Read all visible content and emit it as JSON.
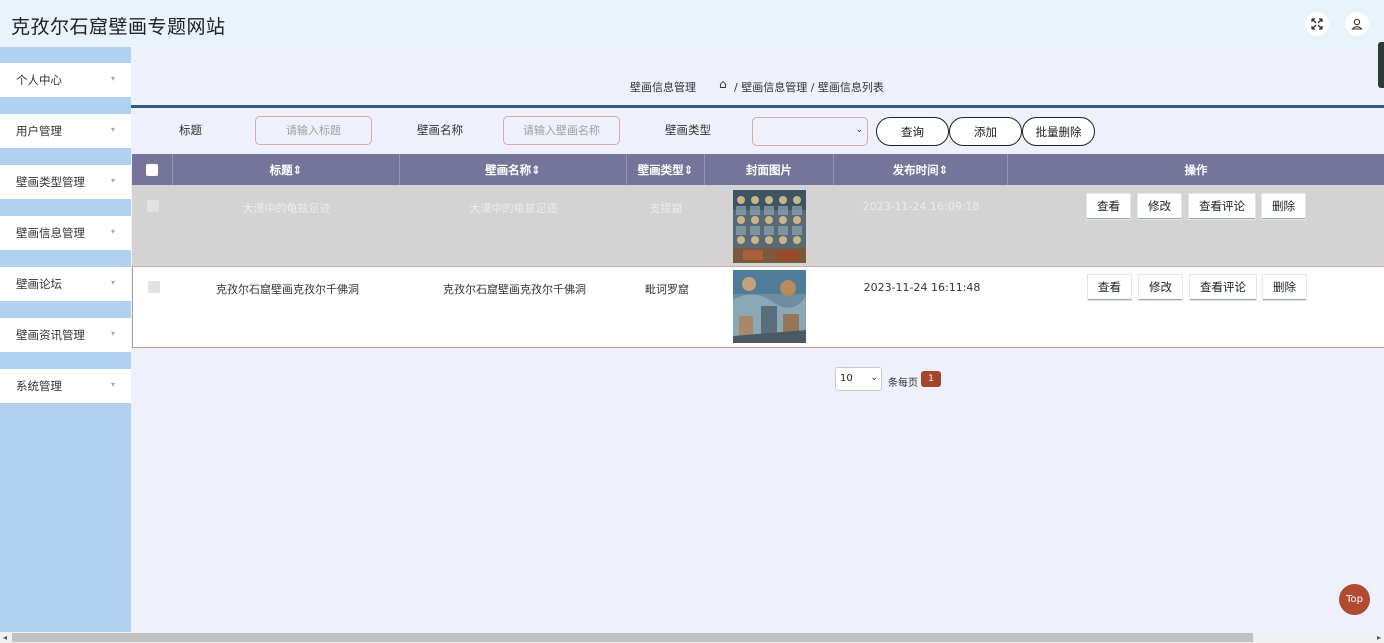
{
  "app": {
    "title": "克孜尔石窟壁画专题网站"
  },
  "header_icons": [
    "fullscreen-icon",
    "user-icon"
  ],
  "sidebar": {
    "items": [
      {
        "label": "个人中心"
      },
      {
        "label": "用户管理"
      },
      {
        "label": "壁画类型管理"
      },
      {
        "label": "壁画信息管理"
      },
      {
        "label": "壁画论坛"
      },
      {
        "label": "壁画资讯管理"
      },
      {
        "label": "系统管理"
      }
    ]
  },
  "breadcrumb": {
    "title": "壁画信息管理",
    "path": "/ 壁画信息管理 / 壁画信息列表"
  },
  "search": {
    "title_label": "标题",
    "title_placeholder": "请输入标题",
    "name_label": "壁画名称",
    "name_placeholder": "请输入壁画名称",
    "type_label": "壁画类型",
    "type_value": "",
    "query_button": "查询",
    "add_button": "添加",
    "batch_delete_button": "批量删除"
  },
  "table": {
    "columns": [
      "标题⇕",
      "壁画名称⇕",
      "壁画类型⇕",
      "封面图片",
      "发布时间⇕",
      "操作"
    ],
    "rows": [
      {
        "title": "大漠中的龟兹足迹",
        "name": "大漠中的龟兹足迹",
        "type": "支提窟",
        "time": "2023-11-24 16:09:18"
      },
      {
        "title": "克孜尔石窟壁画克孜尔千佛洞",
        "name": "克孜尔石窟壁画克孜尔千佛洞",
        "type": "毗诃罗窟",
        "time": "2023-11-24 16:11:48"
      }
    ],
    "actions": [
      "查看",
      "修改",
      "查看评论",
      "删除"
    ]
  },
  "pagination": {
    "page_size": "10",
    "per_page_label": "条每页",
    "current_page": "1"
  },
  "top_button": "Top",
  "colors": {
    "header_bg": "#e9f3fc",
    "sidebar_bg": "#b1d1f0",
    "table_header": "#75749b",
    "accent": "#a4462e",
    "rule": "#2b5d8a"
  }
}
